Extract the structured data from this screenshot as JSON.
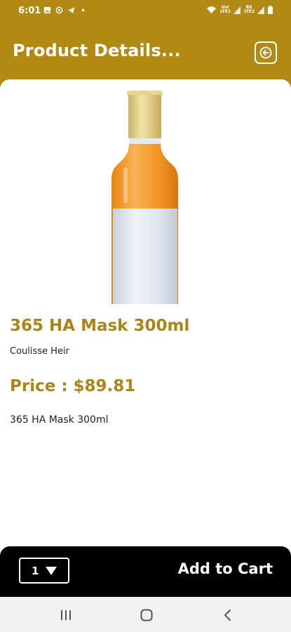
{
  "status_bar": {
    "time": "6:01",
    "network_1": "VoI LTE1",
    "network_2": "R8 LTE2"
  },
  "header": {
    "title": "Product Details..."
  },
  "product": {
    "name": "365 HA Mask 300ml",
    "brand": "Coulisse Heir",
    "price_label": "Price : $89.81",
    "description": "365 HA Mask 300ml"
  },
  "cart": {
    "quantity": "1",
    "button_label": "Add to Cart"
  },
  "colors": {
    "brand_gold": "#b08a14",
    "title_gold": "#a8861a",
    "cart_bar": "#000000"
  },
  "icons": {
    "back": "back-arrow-icon",
    "dropdown": "caret-down-icon",
    "nav_recents": "recents-icon",
    "nav_home": "home-icon",
    "nav_back": "nav-back-icon"
  }
}
